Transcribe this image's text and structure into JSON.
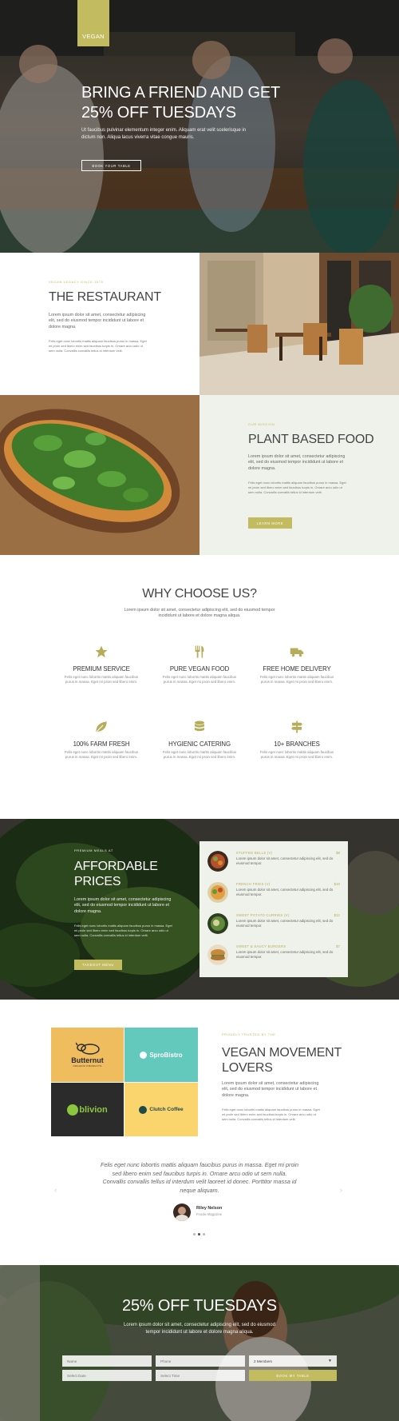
{
  "colors": {
    "accent": "#c2bb5f",
    "accent_dark": "#a8a14c",
    "mint_bg": "#eff2ea",
    "dark_text": "#333333"
  },
  "hero": {
    "badge": "VEGAN",
    "headline_line1": "BRING A FRIEND AND GET",
    "headline_line2": "25% OFF TUESDAYS",
    "body": "Ut faucibus pulvinar elementum integer enim. Aliquam erat velit scelerisque in dictum non. Aliqua lacus viverra vitae congue mauris.",
    "button": "BOOK YOUR TABLE"
  },
  "restaurant": {
    "kicker": "VEGAN LEGACY SINCE 1975",
    "title": "THE RESTAURANT",
    "para1": "Lorem ipsum dolor sit amet, consectetur adipiscing elit, sed do eiusmod tempor incididunt ut labore et dolore magna.",
    "para2": "Felis eget nunc lobortis mattis aliquam faucibus purus in massa. Eget mi proin sed libero enim sed faucibus turpis in. Ornare arcu odio ut sem nulla. Convallis convallis tellus id interdum velit."
  },
  "mission": {
    "kicker": "OUR MISSION",
    "title": "PLANT BASED FOOD",
    "para1": "Lorem ipsum dolor sit amet, consectetur adipiscing elit, sed do eiusmod tempor incididunt ut labore et dolore magna.",
    "para2": "Felis eget nunc lobortis mattis aliquam faucibus purus in massa. Eget mi proin sed libero enim sed faucibus turpis in. Ornare arcu odio ut sem nulla. Convallis convallis tellus id interdum velit.",
    "button": "LEARN MORE"
  },
  "why": {
    "title": "WHY CHOOSE US?",
    "intro": "Lorem ipsum dolor sit amet, consectetur adipiscing elit, sed do eiusmod tempor incididunt ut labore et dolore magna aliqua.",
    "features": [
      {
        "icon": "star-icon",
        "title": "PREMIUM SERVICE",
        "desc": "Felis eget nunc lobortis mattis aliquam faucibus purus in massa. Eget mi proin sed libero enim."
      },
      {
        "icon": "utensils-icon",
        "title": "PURE VEGAN FOOD",
        "desc": "Felis eget nunc lobortis mattis aliquam faucibus purus in massa. Eget mi proin sed libero enim."
      },
      {
        "icon": "truck-icon",
        "title": "FREE HOME DELIVERY",
        "desc": "Felis eget nunc lobortis mattis aliquam faucibus purus in massa. Eget mi proin sed libero enim."
      },
      {
        "icon": "leaf-icon",
        "title": "100% FARM FRESH",
        "desc": "Felis eget nunc lobortis mattis aliquam faucibus purus in massa. Eget mi proin sed libero enim."
      },
      {
        "icon": "database-icon",
        "title": "HYGIENIC CATERING",
        "desc": "Felis eget nunc lobortis mattis aliquam faucibus purus in massa. Eget mi proin sed libero enim."
      },
      {
        "icon": "signpost-icon",
        "title": "10+ BRANCHES",
        "desc": "Felis eget nunc lobortis mattis aliquam faucibus purus in massa. Eget mi proin sed libero enim."
      }
    ]
  },
  "prices": {
    "kicker": "PREMIUM MEALS AT",
    "title_line1": "AFFORDABLE",
    "title_line2": "PRICES",
    "para1": "Lorem ipsum dolor sit amet, consectetur adipiscing elit, sed do eiusmod tempor incididunt ut labore et dolore magna.",
    "para2": "Felis eget nunc lobortis mattis aliquam faucibus purus in massa. Eget mi proin sed libero enim sed faucibus turpis in. Ornare arcu odio ut sem nulla. Convallis convallis tellus id interdum velit.",
    "button": "TAKEOUT MENU",
    "menu": [
      {
        "name": "STUFFED BELLS (V)",
        "price": "$8",
        "desc": "Lorem ipsum dolor sit amet, consectetur adipiscing elit, sed do eiusmod tempor."
      },
      {
        "name": "FRENCH FRIES (V)",
        "price": "$10",
        "desc": "Lorem ipsum dolor sit amet, consectetur adipiscing elit, sed do eiusmod tempor."
      },
      {
        "name": "SWEET POTATO CURRIES (V)",
        "price": "$12",
        "desc": "Lorem ipsum dolor sit amet, consectetur adipiscing elit, sed do eiusmod tempor."
      },
      {
        "name": "SWEET & SAUCY BURGERS",
        "price": "$7",
        "desc": "Lorem ipsum dolor sit amet, consectetur adipiscing elit, sed do eiusmod tempor."
      }
    ]
  },
  "lovers": {
    "logos": [
      {
        "name": "Butternut",
        "sub": "ORGANIC PRODUCTS"
      },
      {
        "name": "SproBistro",
        "sub": ""
      },
      {
        "name": "blivion",
        "sub": ""
      },
      {
        "name": "Clutch Coffee",
        "sub": ""
      }
    ],
    "kicker": "PROUDLY TRUSTED BY THE",
    "title_line1": "VEGAN MOVEMENT",
    "title_line2": "LOVERS",
    "para1": "Lorem ipsum dolor sit amet, consectetur adipiscing elit, sed do eiusmod tempor incididunt ut labore et dolore magna.",
    "para2": "Felis eget nunc lobortis mattis aliquam faucibus purus in massa. Eget mi proin sed libero enim sed faucibus turpis in. Ornare arcu odio ut sem nulla. Convallis convallis tellus id interdum velit."
  },
  "testimonial": {
    "quote": "Felis eget nunc lobortis mattis aliquam faucibus purus in massa. Eget mi proin sed libero enim sed faucibus turpis in. Ornare arcu odio ut sem nulla. Convallis convallis tellus id interdum velit laoreet id donec. Porttitor massa id neque aliquam.",
    "name": "Riley Nelson",
    "role": "Foodie Magazine"
  },
  "booking": {
    "title": "25% OFF TUESDAYS",
    "intro": "Lorem ipsum dolor sit amet, consectetur adipiscing elit, sed do eiusmod tempor incididunt ut labore et dolore magna aliqua.",
    "name_placeholder": "Name",
    "phone_placeholder": "Phone",
    "guests_value": "2 Members",
    "date_placeholder": "Select Date",
    "time_placeholder": "Select Time",
    "button": "BOOK MY TABLE"
  }
}
